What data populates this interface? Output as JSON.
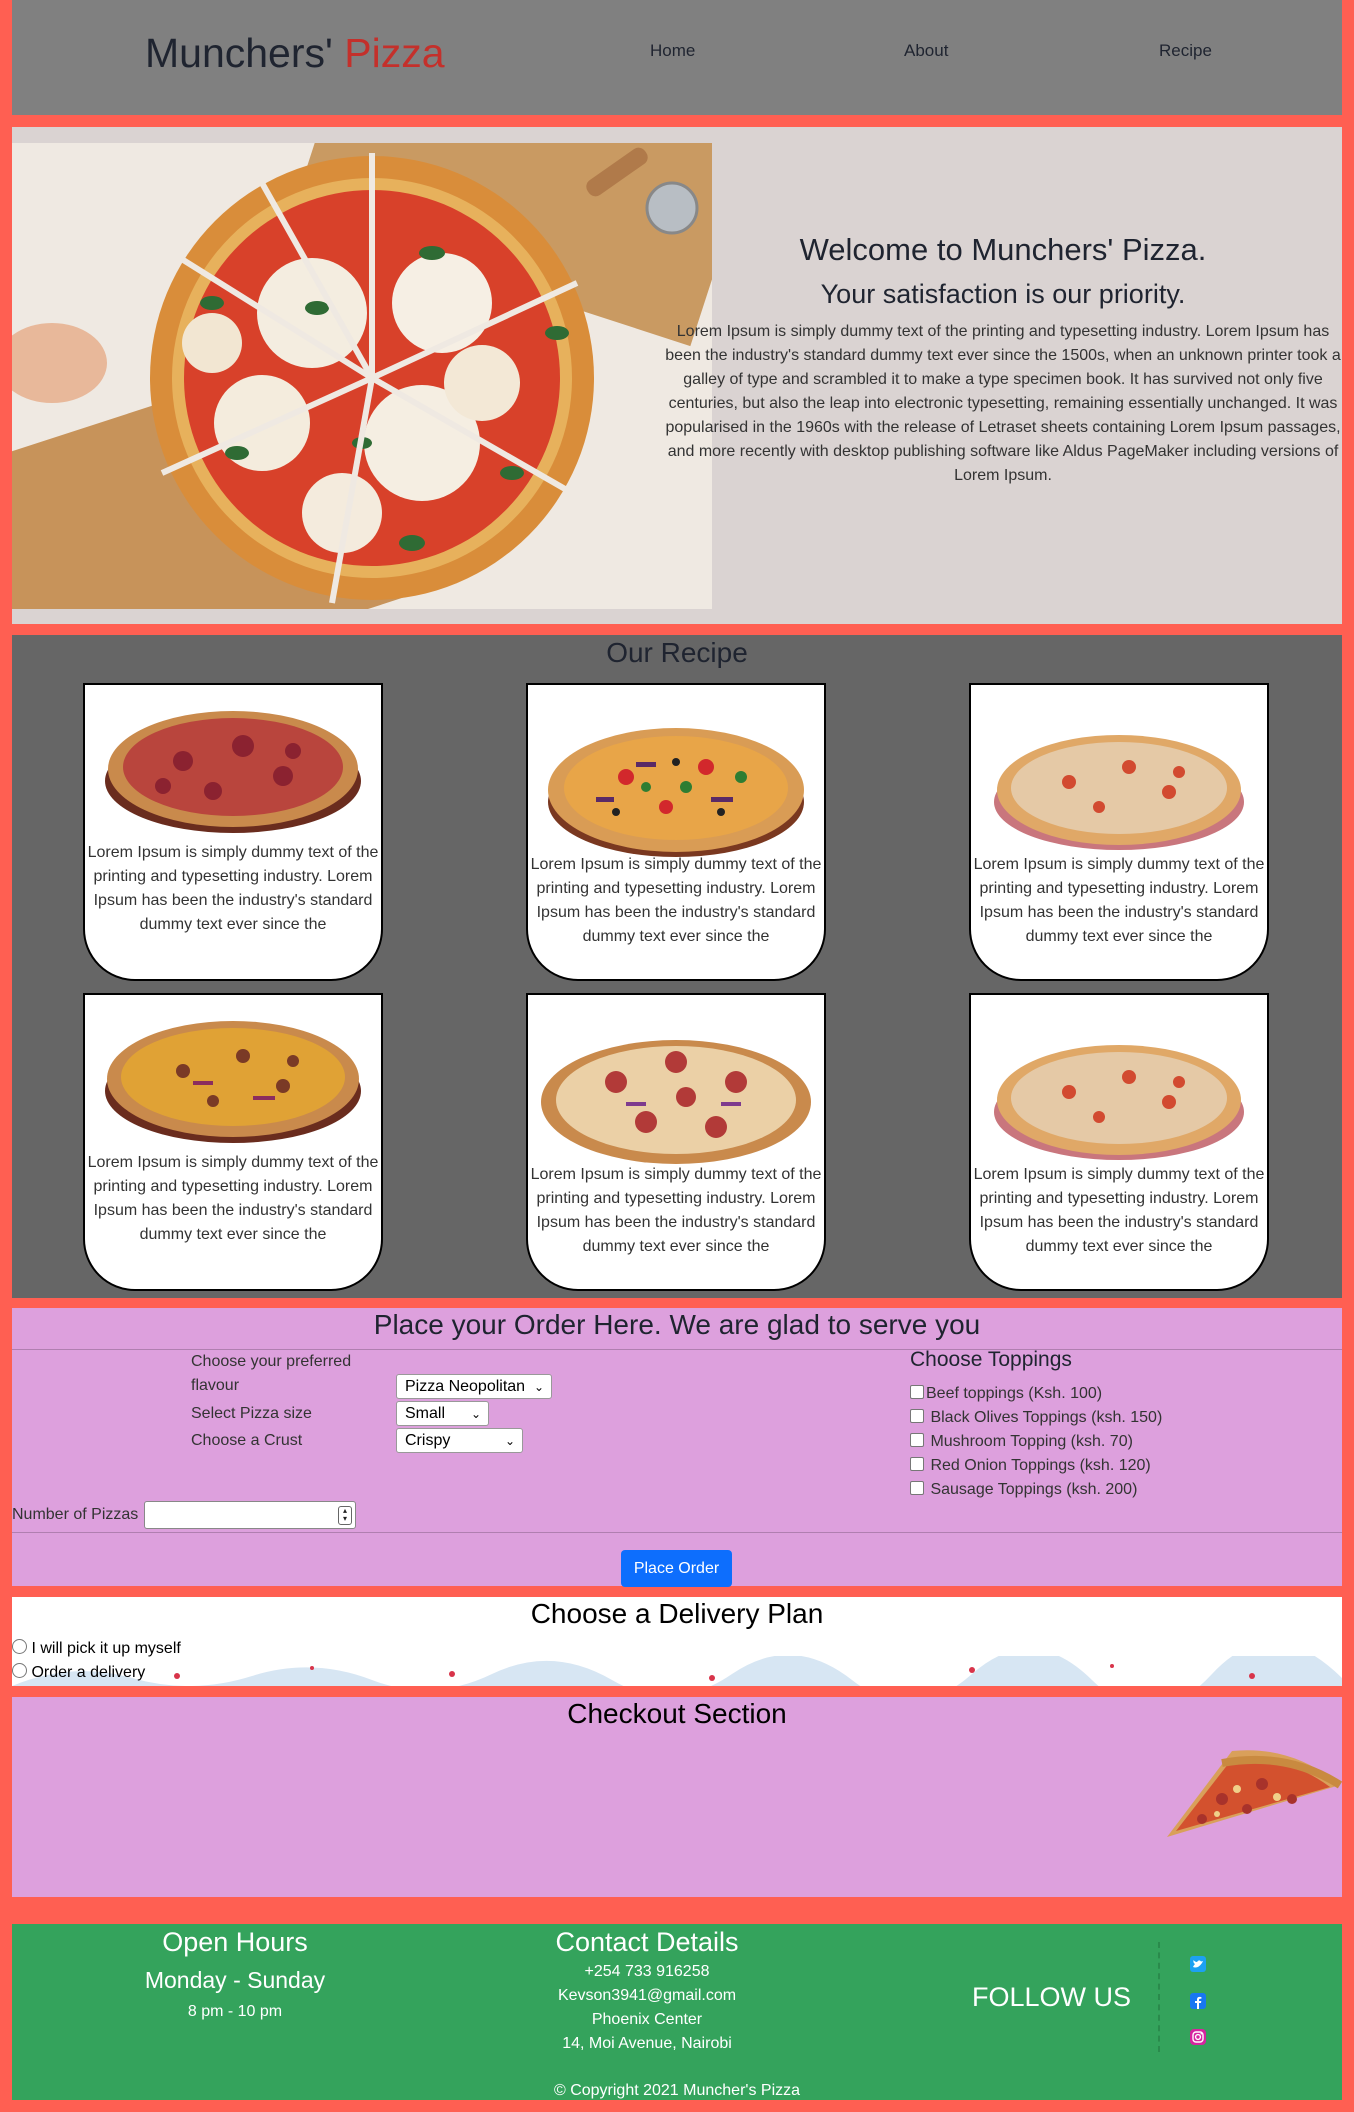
{
  "header": {
    "brand_main": "Munchers' ",
    "brand_accent": "Pizza",
    "nav": [
      "Home",
      "About",
      "Recipe"
    ]
  },
  "hero": {
    "title": "Welcome to Munchers' Pizza.",
    "subtitle": "Your satisfaction is our priority.",
    "body": "Lorem Ipsum is simply dummy text of the printing and typesetting industry. Lorem Ipsum has been the industry's standard dummy text ever since the 1500s, when an unknown printer took a galley of type and scrambled it to make a type specimen book. It has survived not only five centuries, but also the leap into electronic typesetting, remaining essentially unchanged. It was popularised in the 1960s with the release of Letraset sheets containing Lorem Ipsum passages, and more recently with desktop publishing software like Aldus PageMaker including versions of Lorem Ipsum."
  },
  "recipe": {
    "title": "Our Recipe",
    "card_text": "Lorem Ipsum is simply dummy text of the printing and typesetting industry. Lorem Ipsum has been the industry's standard dummy text ever since the"
  },
  "order": {
    "title": "Place your Order Here. We are glad to serve you",
    "flavour_label": "Choose your preferred flavour",
    "flavour_value": "Pizza Neopolitan",
    "size_label": "Select Pizza size",
    "size_value": "Small",
    "crust_label": "Choose a Crust",
    "crust_value": "Crispy",
    "toppings_title": "Choose Toppings",
    "toppings": [
      "Beef toppings (Ksh. 100)",
      "Black Olives Toppings (ksh. 150)",
      "Mushroom Topping (ksh. 70)",
      "Red Onion Toppings (ksh. 120)",
      "Sausage Toppings (ksh. 200)"
    ],
    "number_label": "Number of Pizzas",
    "button": "Place Order"
  },
  "delivery": {
    "title": "Choose a Delivery Plan",
    "options": [
      "I will pick it up myself",
      "Order a delivery"
    ]
  },
  "checkout": {
    "title": "Checkout Section"
  },
  "footer": {
    "hours_title": "Open Hours",
    "days": "Monday - Sunday",
    "hours": "8 pm - 10 pm",
    "contact_title": "Contact Details",
    "phone": "+254 733 916258",
    "email": "Kevson3941@gmail.com",
    "building": "Phoenix Center",
    "address": "14, Moi Avenue, Nairobi",
    "follow": "FOLLOW US",
    "copyright": "© Copyright 2021 Muncher's Pizza"
  },
  "colors": {
    "page_border": "#ff5f52",
    "header_bg": "#808080",
    "hero_bg": "#dad3d2",
    "recipe_bg": "#666666",
    "order_bg": "#dda0dd",
    "footer_bg": "#34a35c",
    "brand_accent": "#c4302b",
    "button": "#0d6efd"
  }
}
